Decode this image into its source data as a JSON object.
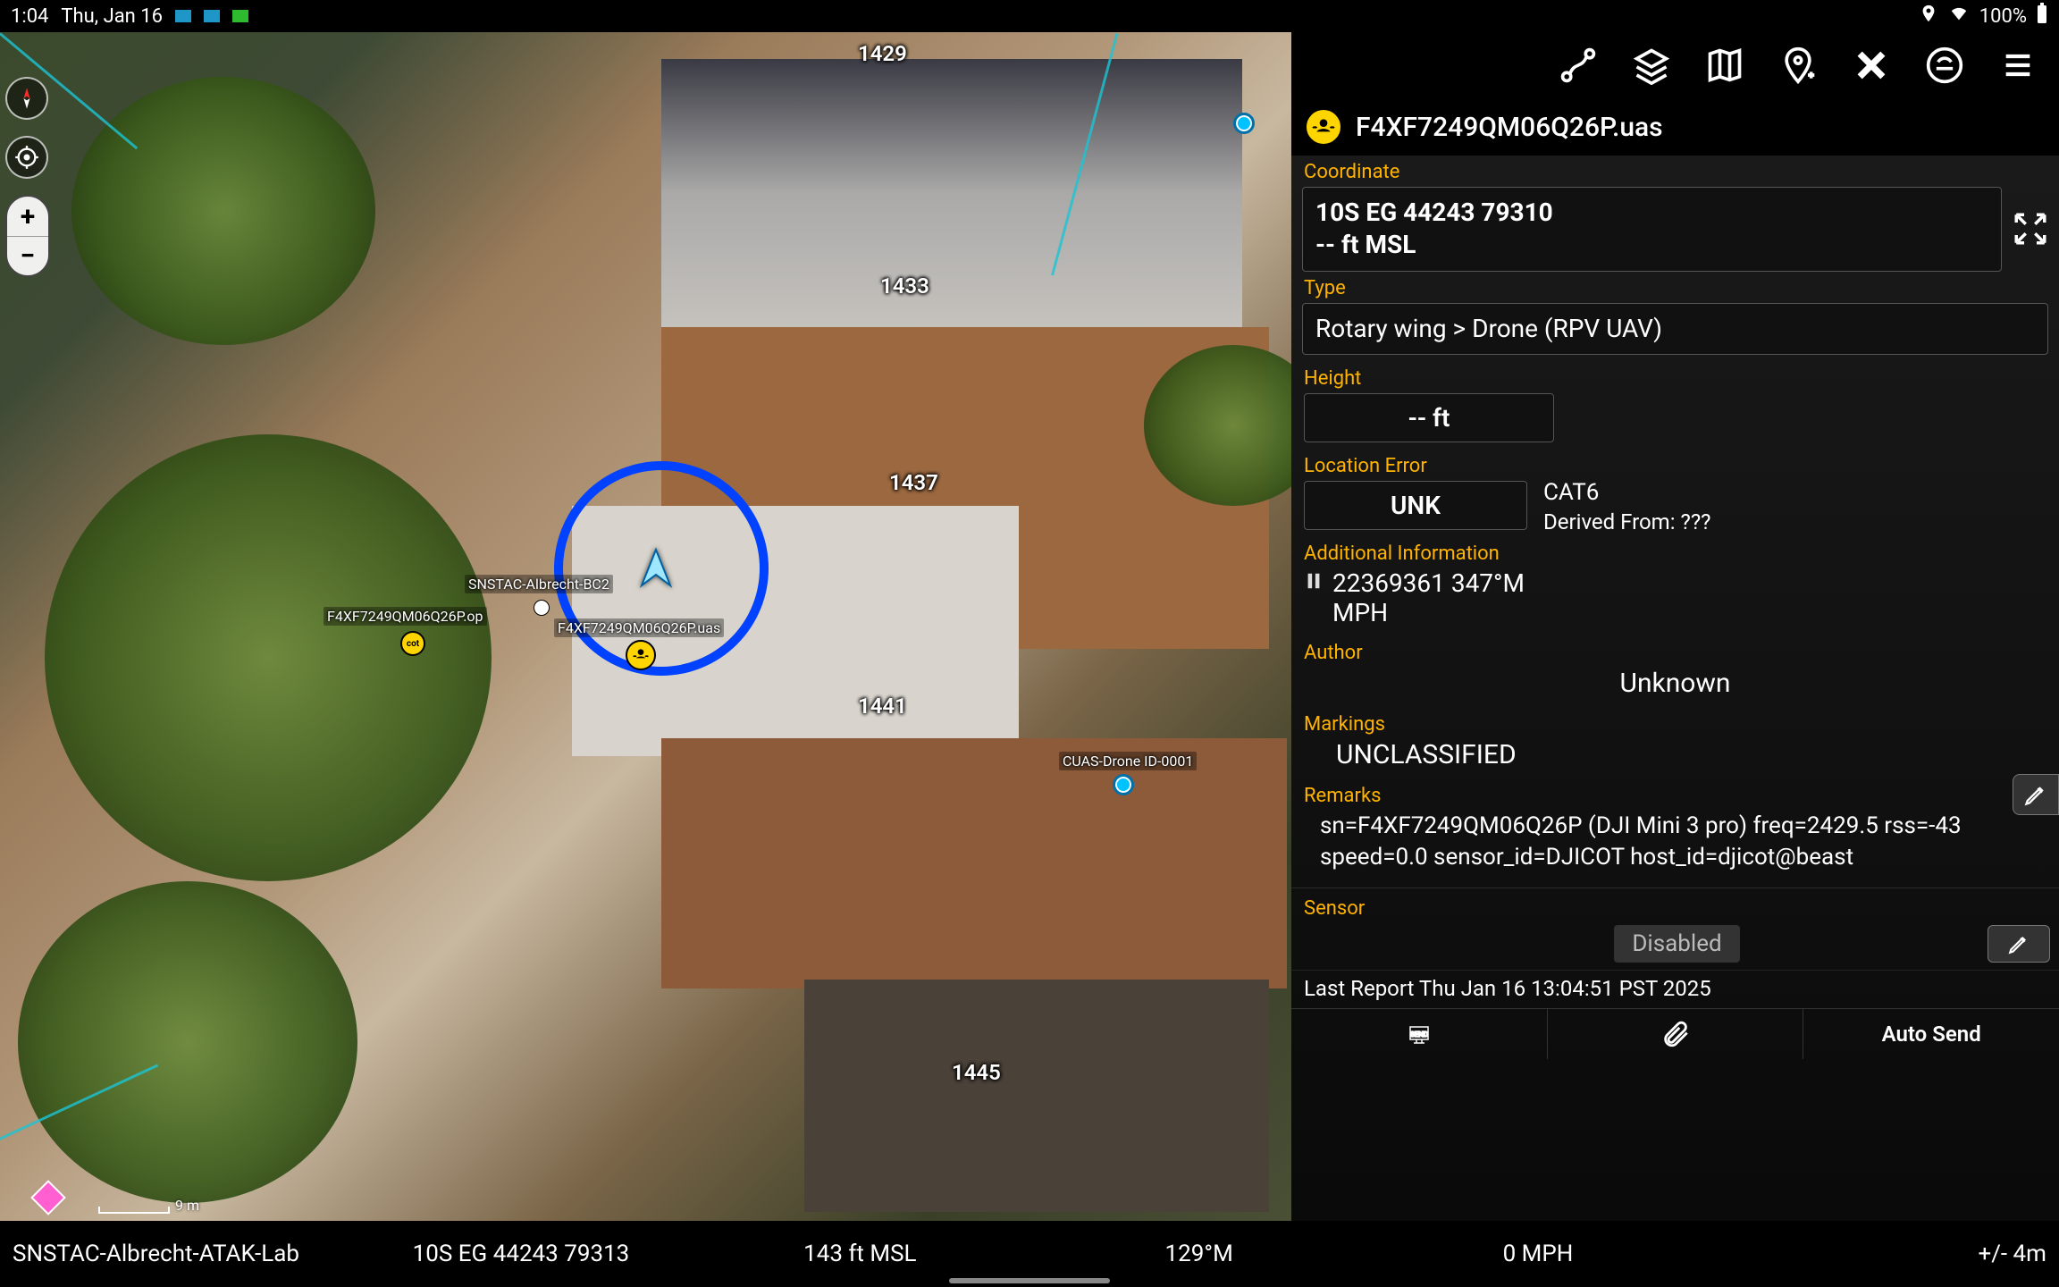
{
  "status": {
    "time": "1:04",
    "date": "Thu, Jan 16",
    "battery": "100%"
  },
  "map": {
    "addresses": [
      "1429",
      "1433",
      "1437",
      "1441",
      "1445"
    ],
    "markers": {
      "self": "SNSTAC-Albrecht-BC2",
      "op": "F4XF7249QM06Q26P.op",
      "uas": "F4XF7249QM06Q26P.uas",
      "cuas": "CUAS-Drone ID-0001"
    },
    "scale": "9 m"
  },
  "detail": {
    "title": "F4XF7249QM06Q26P.uas",
    "labels": {
      "coordinate": "Coordinate",
      "type": "Type",
      "height": "Height",
      "location_error": "Location Error",
      "additional_info": "Additional Information",
      "author": "Author",
      "markings": "Markings",
      "remarks": "Remarks",
      "sensor": "Sensor"
    },
    "coordinate": {
      "mgrs": "10S EG 44243 79310",
      "alt": "-- ft MSL"
    },
    "type_value": "Rotary wing > Drone (RPV UAV)",
    "height_value": "-- ft",
    "location_error": {
      "button": "UNK",
      "category": "CAT6",
      "derived": "Derived From: ???"
    },
    "additional": {
      "line1": "22369361 347°M",
      "line2": "MPH"
    },
    "author": "Unknown",
    "markings": "UNCLASSIFIED",
    "remarks": "sn=F4XF7249QM06Q26P (DJI Mini 3 pro) freq=2429.5 rss=-43 speed=0.0 sensor_id=DJICOT host_id=djicot@beast",
    "sensor_status": "Disabled",
    "last_report": "Last Report Thu Jan 16 13:04:51 PST 2025",
    "actions": {
      "send": "SEND",
      "auto_send": "Auto Send"
    }
  },
  "bottom": {
    "callsign": "SNSTAC-Albrecht-ATAK-Lab",
    "mgrs": "10S  EG  44243  79313",
    "alt": "143 ft MSL",
    "heading": "129°M",
    "speed": "0 MPH",
    "acc": "+/- 4m"
  }
}
